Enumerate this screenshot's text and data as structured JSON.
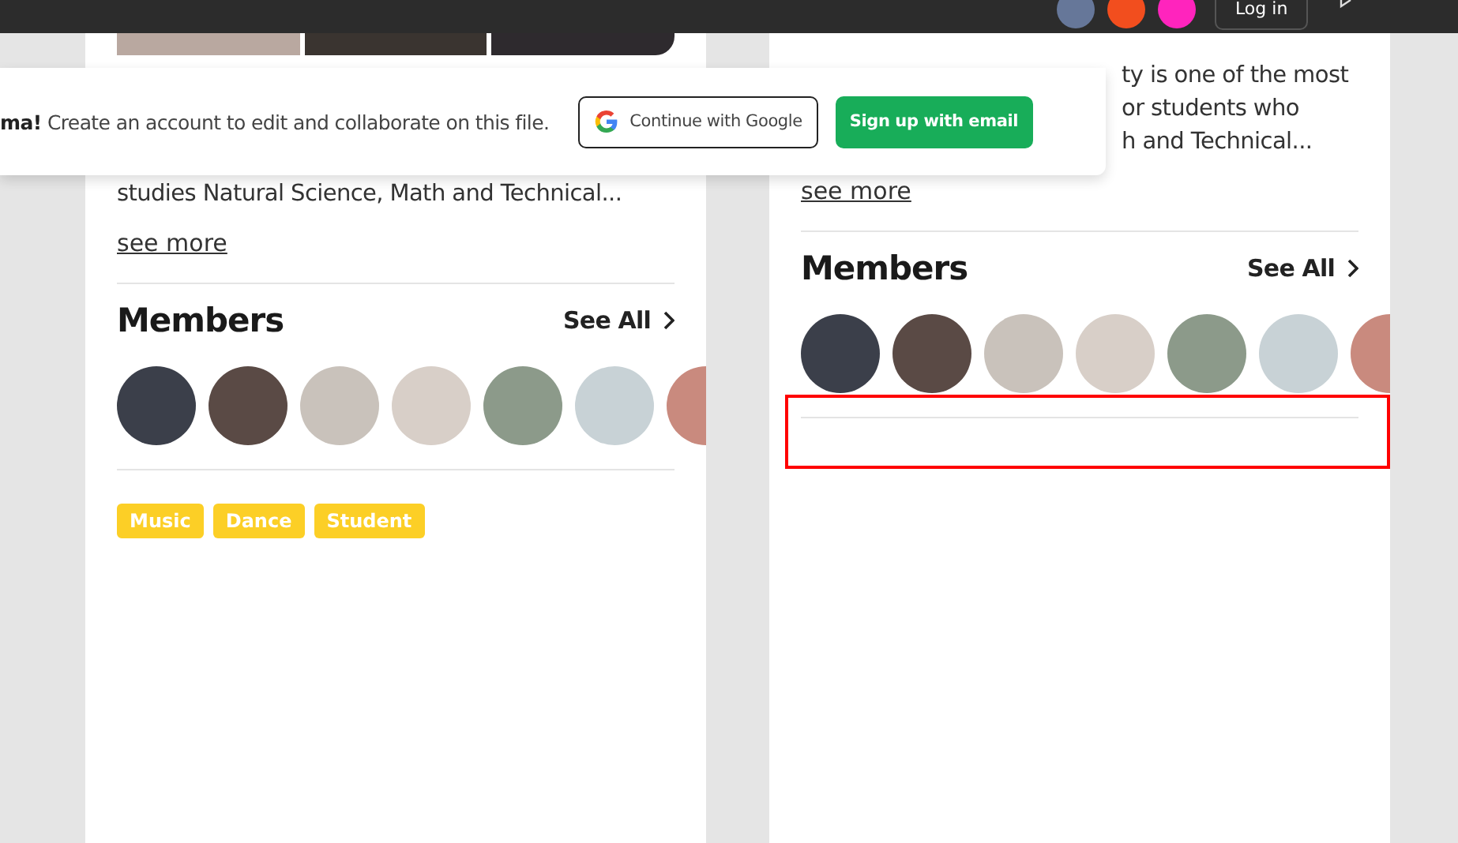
{
  "top_bar": {
    "collaborators": [
      {
        "color": "#667799"
      },
      {
        "color": "#f24e1e"
      },
      {
        "color": "#ff24bd"
      }
    ],
    "login_button": "Log in"
  },
  "cards": [
    {
      "photo_strip": true,
      "description": [
        "studies Natural Science, Math and Technical..."
      ],
      "see_more": "see more",
      "members_title": "Members",
      "see_all": "See All",
      "members": [
        {
          "kind": "photo"
        },
        {
          "kind": "photo"
        },
        {
          "kind": "photo"
        },
        {
          "kind": "photo"
        },
        {
          "kind": "photo"
        },
        {
          "kind": "photo"
        },
        {
          "kind": "photo"
        }
      ],
      "tags": [
        "Music",
        "Dance",
        "Student"
      ],
      "highlighted": false
    },
    {
      "photo_strip": false,
      "description": [
        "ty is one of the most",
        "or students who",
        "h and Technical..."
      ],
      "see_more": "see more",
      "members_title": "Members",
      "see_all": "See All",
      "members": [
        {
          "kind": "photo"
        },
        {
          "kind": "photo"
        },
        {
          "kind": "photo"
        },
        {
          "kind": "photo"
        },
        {
          "kind": "photo"
        },
        {
          "kind": "photo"
        },
        {
          "kind": "photo"
        }
      ],
      "highlighted": true
    }
  ],
  "signup_banner": {
    "message": "**ma!** Create an account to edit and collaborate on this file.",
    "google_button": "Continue with Google",
    "email_button": "Sign up with email"
  }
}
